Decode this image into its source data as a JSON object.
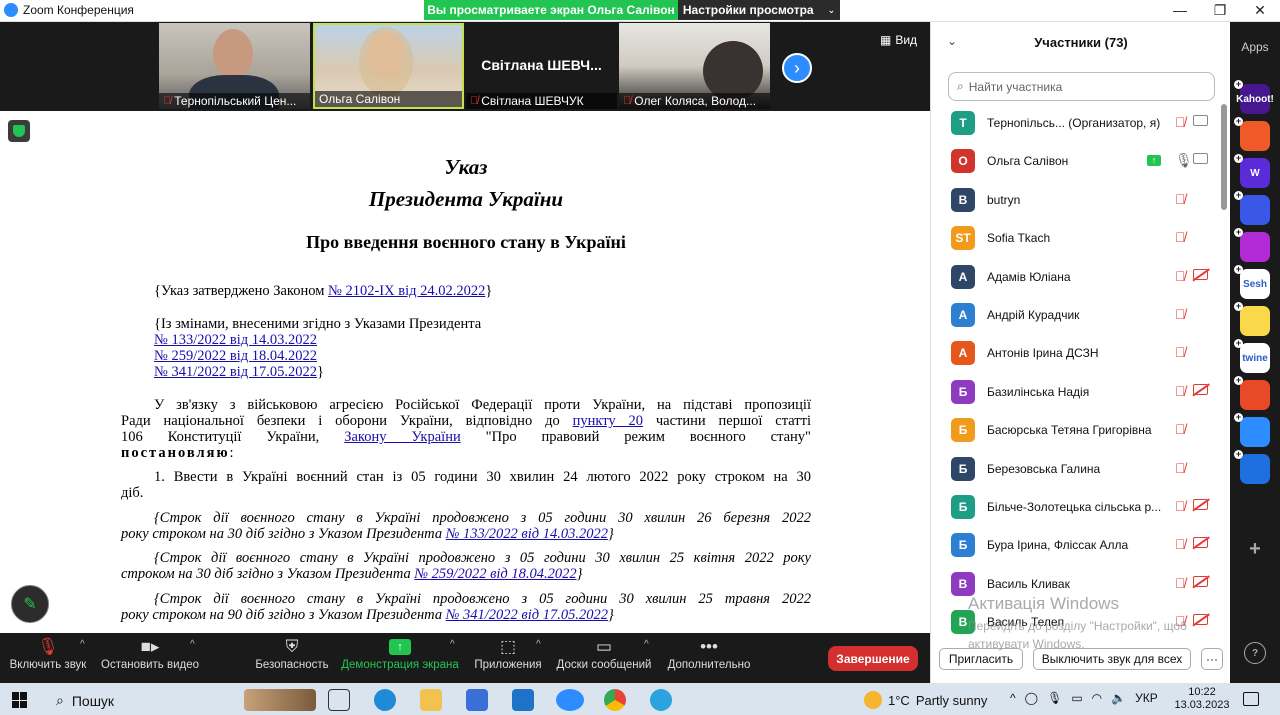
{
  "window": {
    "title": "Zoom Конференция",
    "banner_text": "Вы просматриваете экран Ольга Салівон",
    "view_settings": "Настройки просмотра"
  },
  "videos": {
    "view_label": "Вид",
    "tiles": [
      {
        "name": "Тернопільський Цен..."
      },
      {
        "name": "Ольга Салівон"
      },
      {
        "name": "Світлана ШЕВЧУК",
        "display_name": "Світлана ШЕВЧ..."
      },
      {
        "name": "Олег Коляса, Волод..."
      }
    ]
  },
  "document": {
    "title1": "Указ",
    "title2": "Президента України",
    "heading": "Про введення воєнного стану в Україні",
    "approved_prefix": "{Указ затверджено Законом ",
    "approved_link": "№ 2102-IX від 24.02.2022",
    "approved_suffix": "}",
    "changes_text": "{Із змінами, внесеними згідно з Указами Президента",
    "change_links": [
      "№ 133/2022 від 14.03.2022",
      "№ 259/2022 від 18.04.2022",
      "№ 341/2022 від 17.05.2022"
    ],
    "change_close": "}",
    "p1_line1": "У зв'язку з військовою агресією Російської Федерації проти України, на підставі пропозиції",
    "p1_line2_a": "Ради національної безпеки і оборони України, відповідно до ",
    "p1_line2_link": "пункту 20",
    "p1_line2_b": " частини першої статті",
    "p1_line3_a": "106 Конституції України, ",
    "p1_line3_link": "Закону України",
    "p1_line3_b": " \"Про правовий режим воєнного стану\"",
    "p1_line4_bold": "постановляю",
    "p1_line4_rest": ":",
    "p2_line1": "1. Ввести в Україні воєнний стан із 05 години 30 хвилин 24 лютого 2022 року строком на 30",
    "p2_line2": "діб.",
    "p3_line1": "{Строк дії воєнного стану в Україні продовжено з 05 години 30 хвилин 26 березня 2022",
    "p3_line2_a": "року строком на 30 діб згідно з Указом Президента ",
    "p3_line2_link": "№ 133/2022 від 14.03.2022",
    "p3_line2_b": "}",
    "p4_line1": "{Строк дії воєнного стану в Україні продовжено з 05 години 30 хвилин 25 квітня 2022 року",
    "p4_line2_a": "строком на 30 діб згідно з Указом Президента ",
    "p4_line2_link": "№ 259/2022 від 18.04.2022",
    "p4_line2_b": "}",
    "p5_line1": "{Строк дії воєнного стану в Україні продовжено з 05 години 30 хвилин 25 травня 2022",
    "p5_line2_a": "року строком на 90 діб згідно з Указом Президента ",
    "p5_line2_link": "№ 341/2022 від 17.05.2022",
    "p5_line2_b": "}"
  },
  "controls": {
    "unmute": "Включить звук",
    "stop_video": "Остановить видео",
    "security": "Безопасность",
    "share_screen": "Демонстрация экрана",
    "apps": "Приложения",
    "whiteboards": "Доски сообщений",
    "more": "Дополнительно",
    "end": "Завершение"
  },
  "participants_panel": {
    "title": "Участники (73)",
    "search_placeholder": "Найти участника",
    "participants": [
      {
        "initials": "Т",
        "name": "Тернопільсь...  (Организатор, я)",
        "color": "#1e9e86"
      },
      {
        "initials": "О",
        "name": "Ольга Салівон",
        "color": "#d0342c"
      },
      {
        "initials": "B",
        "name": "butryn",
        "color": "#2f4766"
      },
      {
        "initials": "ST",
        "name": "Sofia Tkach",
        "color": "#f19a1b"
      },
      {
        "initials": "А",
        "name": "Адамів Юліана",
        "color": "#2f4766"
      },
      {
        "initials": "А",
        "name": "Андрій Курадчик",
        "color": "#2d7fd1"
      },
      {
        "initials": "А",
        "name": "Антонів Ірина ДСЗН",
        "color": "#e4581b"
      },
      {
        "initials": "Б",
        "name": "Базилінська Надія",
        "color": "#8e3bbf"
      },
      {
        "initials": "Б",
        "name": "Басюрська Тетяна Григорівна",
        "color": "#f19a1b"
      },
      {
        "initials": "Б",
        "name": "Березовська Галина",
        "color": "#2f4766"
      },
      {
        "initials": "Б",
        "name": "Більче-Золотецька сільська р...",
        "color": "#1e9e86"
      },
      {
        "initials": "Б",
        "name": "Бура Ірина, Фліссак Алла",
        "color": "#2d7fd1"
      },
      {
        "initials": "В",
        "name": "Василь Кливак",
        "color": "#8e3bbf"
      },
      {
        "initials": "В",
        "name": "Василь Телеп",
        "color": "#23a455"
      }
    ],
    "invite": "Пригласить",
    "mute_all": "Выключить звук для всех",
    "more": "···"
  },
  "watermark": {
    "line1": "Активація Windows",
    "line2": "Перейдіть до розділу \"Настройки\", щоб активувати Windows."
  },
  "apps_bar": {
    "label": "Apps",
    "items": [
      {
        "name": "Kahoot!",
        "color": "#46178f"
      },
      {
        "name": "",
        "color": "#f05a28"
      },
      {
        "name": "W",
        "color": "#5a2bd9"
      },
      {
        "name": "",
        "color": "#3a57e8"
      },
      {
        "name": "",
        "color": "#b02bd6"
      },
      {
        "name": "Sesh",
        "color": "#ffffff"
      },
      {
        "name": "",
        "color": "#f9d949"
      },
      {
        "name": "twine",
        "color": "#ffffff"
      },
      {
        "name": "",
        "color": "#e84a27"
      },
      {
        "name": "",
        "color": "#2d8cff"
      },
      {
        "name": "",
        "color": "#1e6fe0"
      }
    ]
  },
  "taskbar": {
    "search": "Пошук",
    "weather_temp": "1°C",
    "weather_text": "Partly sunny",
    "lang": "УКР",
    "time": "10:22",
    "date": "13.03.2023"
  }
}
